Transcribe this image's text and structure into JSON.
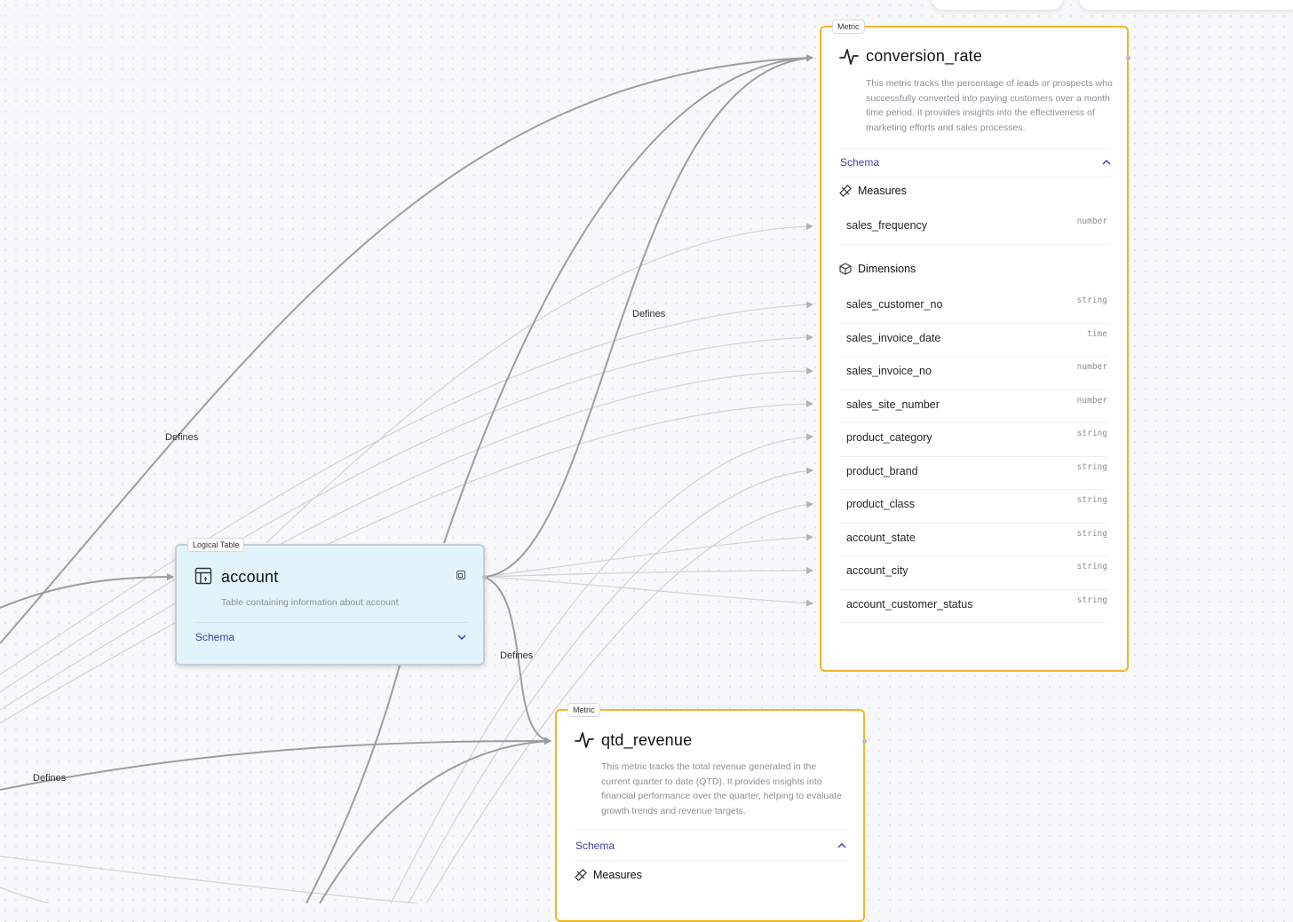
{
  "edge_labels": [
    "Defines",
    "Defines",
    "Defines",
    "Defines"
  ],
  "nodes": {
    "conversion_rate": {
      "tag": "Metric",
      "icon": "activity-icon",
      "title": "conversion_rate",
      "description": "This metric tracks the percentage of leads or prospects who successfully converted into paying customers over a month time period. It provides insights into the effectiveness of marketing efforts and sales processes.",
      "schema_label": "Schema",
      "schema_state": "expanded",
      "measures_label": "Measures",
      "measures": [
        {
          "name": "sales_frequency",
          "type": "number"
        }
      ],
      "dimensions_label": "Dimensions",
      "dimensions": [
        {
          "name": "sales_customer_no",
          "type": "string"
        },
        {
          "name": "sales_invoice_date",
          "type": "time"
        },
        {
          "name": "sales_invoice_no",
          "type": "number"
        },
        {
          "name": "sales_site_number",
          "type": "number"
        },
        {
          "name": "product_category",
          "type": "string"
        },
        {
          "name": "product_brand",
          "type": "string"
        },
        {
          "name": "product_class",
          "type": "string"
        },
        {
          "name": "account_state",
          "type": "string"
        },
        {
          "name": "account_city",
          "type": "string"
        },
        {
          "name": "account_customer_status",
          "type": "string"
        }
      ]
    },
    "account": {
      "tag": "Logical Table",
      "icon": "table-icon",
      "title": "account",
      "description": "Table containing information about account",
      "schema_label": "Schema",
      "schema_state": "collapsed"
    },
    "qtd_revenue": {
      "tag": "Metric",
      "icon": "activity-icon",
      "title": "qtd_revenue",
      "description": "This metric tracks the total revenue generated in the current quarter to date (QTD). It provides insights into financial performance over the quarter, helping to evaluate growth trends and revenue targets.",
      "schema_label": "Schema",
      "schema_state": "expanded",
      "measures_label": "Measures"
    }
  },
  "colors": {
    "metric_border": "#f0b429",
    "table_bg": "#e2f4fb",
    "schema_link": "#3b3fa8",
    "edge_strong": "#9a9da2",
    "edge_faint": "#d2d4d8"
  }
}
